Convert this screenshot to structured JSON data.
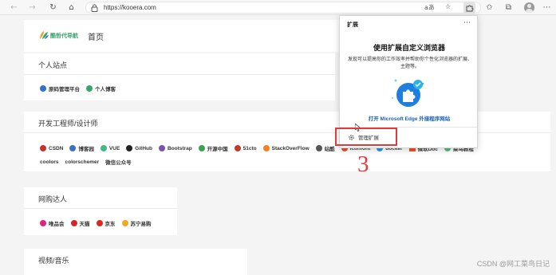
{
  "browser": {
    "url": "https://kooera.com",
    "back_glyph": "←",
    "forward_glyph": "→",
    "refresh_glyph": "↻",
    "home_glyph": "⌂",
    "read_aloud_glyph": "aあ",
    "favorite_glyph": "☆",
    "favorites_glyph": "✩",
    "collections_glyph": "⧉",
    "menu_glyph": "⋯",
    "extensions_glyph": "⚙"
  },
  "site": {
    "logo_text": "酷哲代导航",
    "home_label": "首页"
  },
  "sections": {
    "personal": {
      "title": "个人站点",
      "items": [
        {
          "label": "原码管理平台",
          "color": "#2f6fd6"
        },
        {
          "label": "个人博客",
          "color": "#38a36a"
        }
      ]
    },
    "dev": {
      "title": "开发工程师/设计师",
      "row1": [
        {
          "label": "CSDN",
          "color": "#c9302c"
        },
        {
          "label": "博客园",
          "color": "#3a6fc4"
        },
        {
          "label": "VUE",
          "color": "#42b883"
        },
        {
          "label": "GitHub",
          "color": "#222222"
        },
        {
          "label": "Bootstrap",
          "color": "#7952b3"
        },
        {
          "label": "开源中国",
          "color": "#3aa34e"
        },
        {
          "label": "51cto",
          "color": "#c0392b"
        },
        {
          "label": "StackOverFlow",
          "color": "#f48024"
        },
        {
          "label": "站酷",
          "color": "#555555"
        },
        {
          "label": "iconfont",
          "color": "#e6503c"
        },
        {
          "label": "docker",
          "color": "#2496ed"
        },
        {
          "label": "微软Doc",
          "color": "#f25022"
        },
        {
          "label": "菜鸟教程",
          "color": "#5fb878"
        }
      ],
      "row2": [
        {
          "label": "coolors",
          "color": "#ffffff"
        },
        {
          "label": "colorschemer",
          "color": "#ffffff"
        },
        {
          "label": "微信公众号",
          "color": "#ffffff"
        }
      ]
    },
    "shopping": {
      "title": "网购达人",
      "items": [
        {
          "label": "唯品会",
          "color": "#e2237d"
        },
        {
          "label": "天猫",
          "color": "#d8232a"
        },
        {
          "label": "京东",
          "color": "#e1251b"
        },
        {
          "label": "苏宁易购",
          "color": "#f5a623"
        }
      ]
    },
    "video": {
      "title": "视频/音乐"
    }
  },
  "extensions_popup": {
    "title": "扩展",
    "more_glyph": "⋯",
    "heading": "使用扩展自定义浏览器",
    "description": "发现可以提高你的工作效率并帮助你个性化浏览器的扩展、主题等。",
    "store_link": "打开 Microsoft Edge 外接程序网站",
    "manage_label": "管理扩展"
  },
  "annotation": {
    "number": "3",
    "color": "#e23a3a"
  },
  "watermark": "CSDN @网工菜鸟日记"
}
